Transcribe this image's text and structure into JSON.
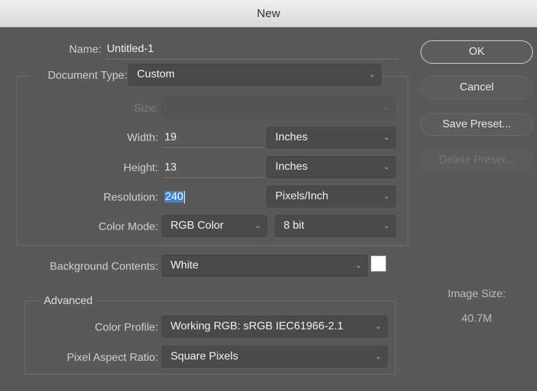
{
  "window": {
    "title": "New"
  },
  "form": {
    "name_label": "Name:",
    "name_value": "Untitled-1",
    "document_type_label": "Document Type:",
    "document_type_value": "Custom",
    "size_label": "Size:",
    "size_value": "",
    "width_label": "Width:",
    "width_value": "19",
    "width_unit": "Inches",
    "height_label": "Height:",
    "height_value": "13",
    "height_unit": "Inches",
    "resolution_label": "Resolution:",
    "resolution_value": "240",
    "resolution_unit": "Pixels/Inch",
    "color_mode_label": "Color Mode:",
    "color_mode_value": "RGB Color",
    "bit_depth_value": "8 bit",
    "background_label": "Background Contents:",
    "background_value": "White",
    "background_swatch_color": "#ffffff"
  },
  "advanced": {
    "title": "Advanced",
    "color_profile_label": "Color Profile:",
    "color_profile_value": "Working RGB:  sRGB IEC61966-2.1",
    "pixel_aspect_label": "Pixel Aspect Ratio:",
    "pixel_aspect_value": "Square Pixels"
  },
  "buttons": {
    "ok": "OK",
    "cancel": "Cancel",
    "save_preset": "Save Preset...",
    "delete_preset": "Delete Preset..."
  },
  "image_size": {
    "label": "Image Size:",
    "value": "40.7M"
  },
  "colors": {
    "accent": "#3b7fd2",
    "dialog_bg": "#595959"
  }
}
